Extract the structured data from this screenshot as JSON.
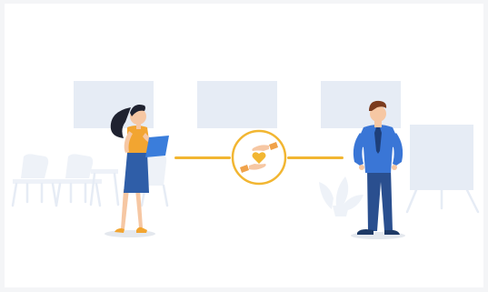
{
  "scene": {
    "colors": {
      "frame": "#f4f5f7",
      "background": "#ffffff",
      "faded_shape": "#e6ecf5",
      "faded_shape_light": "#eef2f8",
      "connector": "#f2b632",
      "badge_ring": "#f2b632",
      "heart": "#f2b632",
      "skin": "#f6c7a3",
      "hand_sleeve": "#f0a24a",
      "woman_hair": "#1f2230",
      "woman_top": "#f2a531",
      "woman_skirt": "#2f5ea8",
      "woman_tablet": "#3a7ddb",
      "woman_shoes": "#f2a531",
      "man_hair": "#7a3b1e",
      "man_shirt": "#3a76d6",
      "man_tie": "#1e3f7a",
      "man_pants": "#2a4f8f",
      "man_shoes": "#1e3a66",
      "shadow": "#e4e8ee"
    },
    "icons": [
      "handshake-heart-icon"
    ]
  }
}
